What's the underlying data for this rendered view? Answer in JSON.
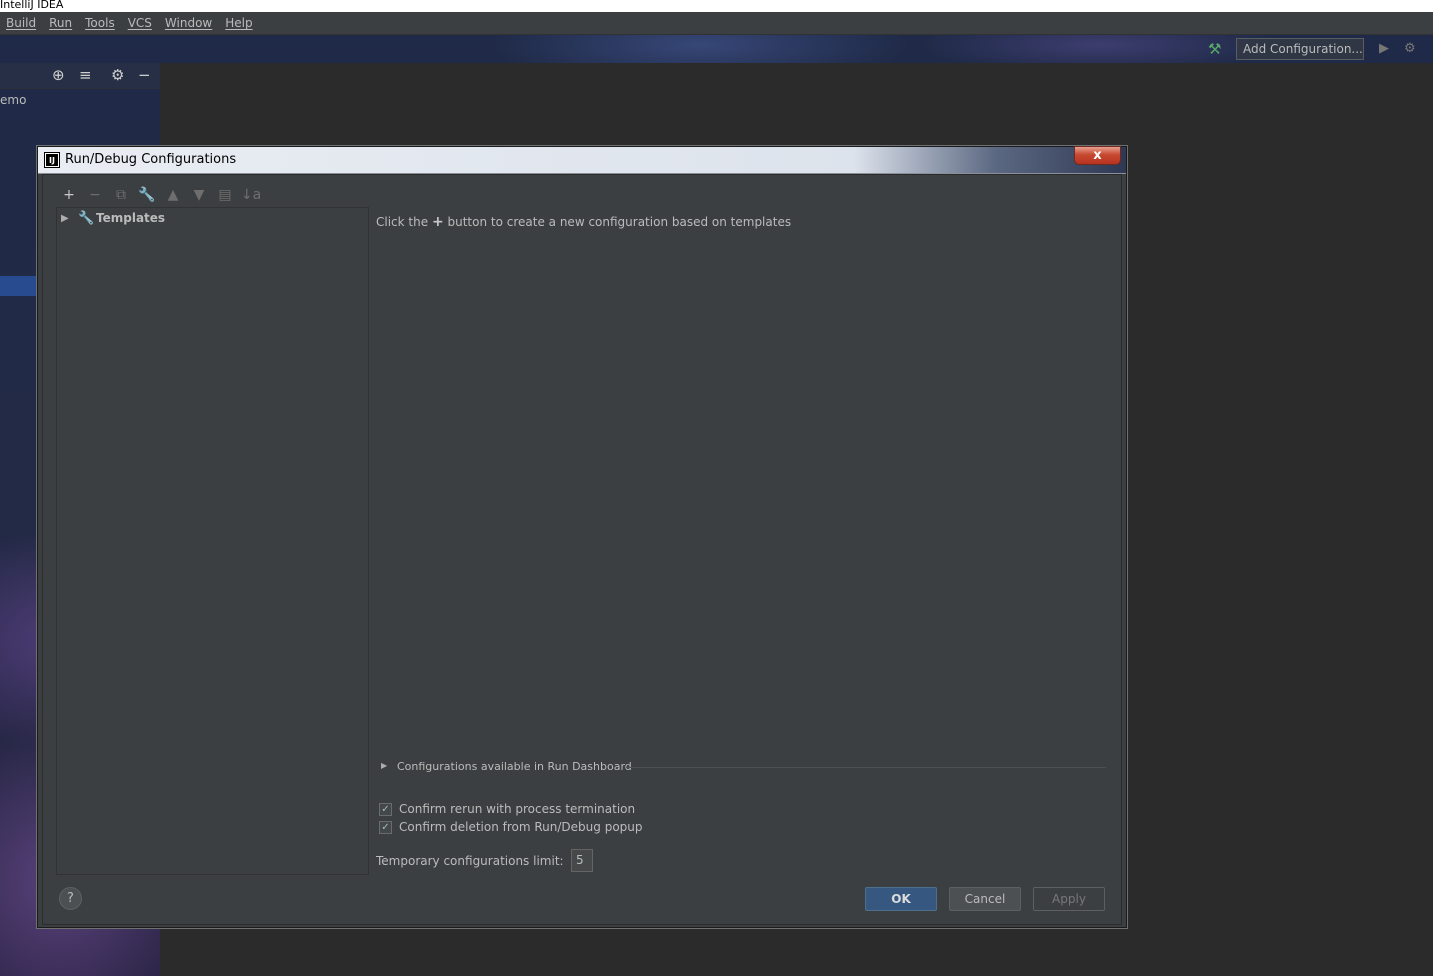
{
  "os": {
    "window_title": "IntelliJ IDEA"
  },
  "menubar": {
    "items": [
      "Build",
      "Run",
      "Tools",
      "VCS",
      "Window",
      "Help"
    ]
  },
  "navbar": {
    "add_configuration": "Add Configuration..."
  },
  "project": {
    "node_label": "emo"
  },
  "icons": {
    "hammer": "hammer-icon",
    "run": "run-icon",
    "debug": "debug-icon",
    "locate": "crosshair-icon",
    "collapse": "collapse-icon",
    "settings": "gear-icon",
    "hide": "minimize-icon"
  },
  "dialog": {
    "title": "Run/Debug Configurations",
    "close_label": "x",
    "toolbar": {
      "add": "+",
      "remove": "−",
      "copy": "⧉",
      "edit_templates": "wrench",
      "move_up": "▲",
      "move_down": "▼",
      "new_folder": "folder",
      "sort": "↓a"
    },
    "tree": {
      "templates_label": "Templates"
    },
    "hint": {
      "before": "Click the",
      "plus": "+",
      "after": "button to create a new configuration based on templates"
    },
    "run_dashboard": {
      "label": "Configurations available in Run Dashboard"
    },
    "options": {
      "confirm_rerun": {
        "label": "Confirm rerun with process termination",
        "checked": true
      },
      "confirm_deletion": {
        "label": "Confirm deletion from Run/Debug popup",
        "checked": true
      }
    },
    "temp_limit": {
      "label": "Temporary configurations limit:",
      "value": "5"
    },
    "buttons": {
      "help": "?",
      "ok": "OK",
      "cancel": "Cancel",
      "apply": "Apply"
    }
  },
  "colors": {
    "accent": "#365880",
    "background": "#3c3f41",
    "text": "#bbbbbb"
  }
}
